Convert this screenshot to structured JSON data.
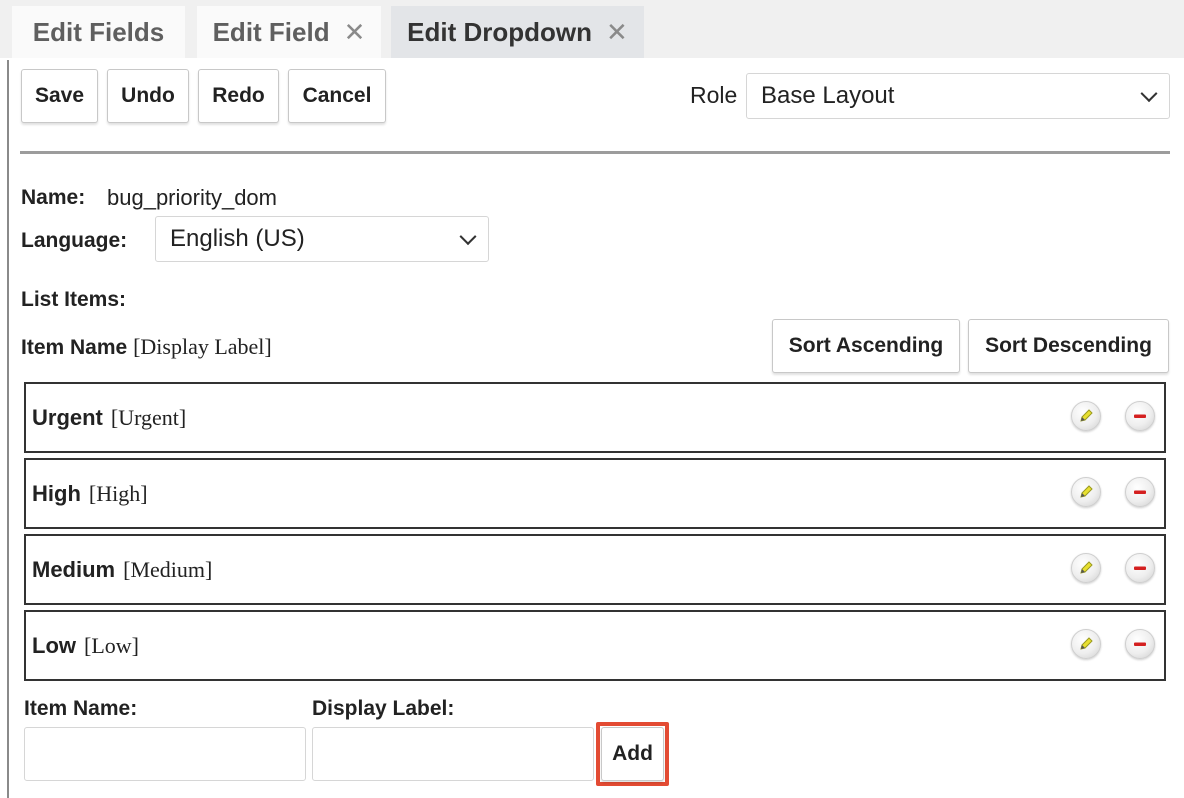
{
  "tabs": [
    {
      "label": "Edit Fields",
      "closable": false
    },
    {
      "label": "Edit Field",
      "closable": true
    },
    {
      "label": "Edit Dropdown",
      "closable": true,
      "active": true
    }
  ],
  "tab_close_glyph": "✕",
  "toolbar": {
    "save_label": "Save",
    "undo_label": "Undo",
    "redo_label": "Redo",
    "cancel_label": "Cancel",
    "role_label": "Role",
    "role_value": "Base Layout"
  },
  "form": {
    "name_label": "Name:",
    "name_value": "bug_priority_dom",
    "language_label": "Language:",
    "language_value": "English (US)",
    "list_items_label": "List Items:",
    "item_name_header": "Item Name",
    "display_label_header": "[Display Label]",
    "sort_ascending_label": "Sort Ascending",
    "sort_descending_label": "Sort Descending"
  },
  "list_items": [
    {
      "name": "Urgent",
      "label": "[Urgent]"
    },
    {
      "name": "High",
      "label": "[High]"
    },
    {
      "name": "Medium",
      "label": "[Medium]"
    },
    {
      "name": "Low",
      "label": "[Low]"
    }
  ],
  "new_item": {
    "item_name_label": "Item Name:",
    "item_name_value": "",
    "display_label_label": "Display Label:",
    "display_label_value": "",
    "add_label": "Add"
  },
  "icons": {
    "edit": "pencil-icon",
    "remove": "minus-circle-icon",
    "close": "close-icon",
    "dropdown": "chevron-down-icon"
  },
  "colors": {
    "active_tab_bg": "#e3e5e8",
    "highlight_border": "#e34b33",
    "remove_icon": "#d42020",
    "edit_icon": "#e0d820"
  }
}
